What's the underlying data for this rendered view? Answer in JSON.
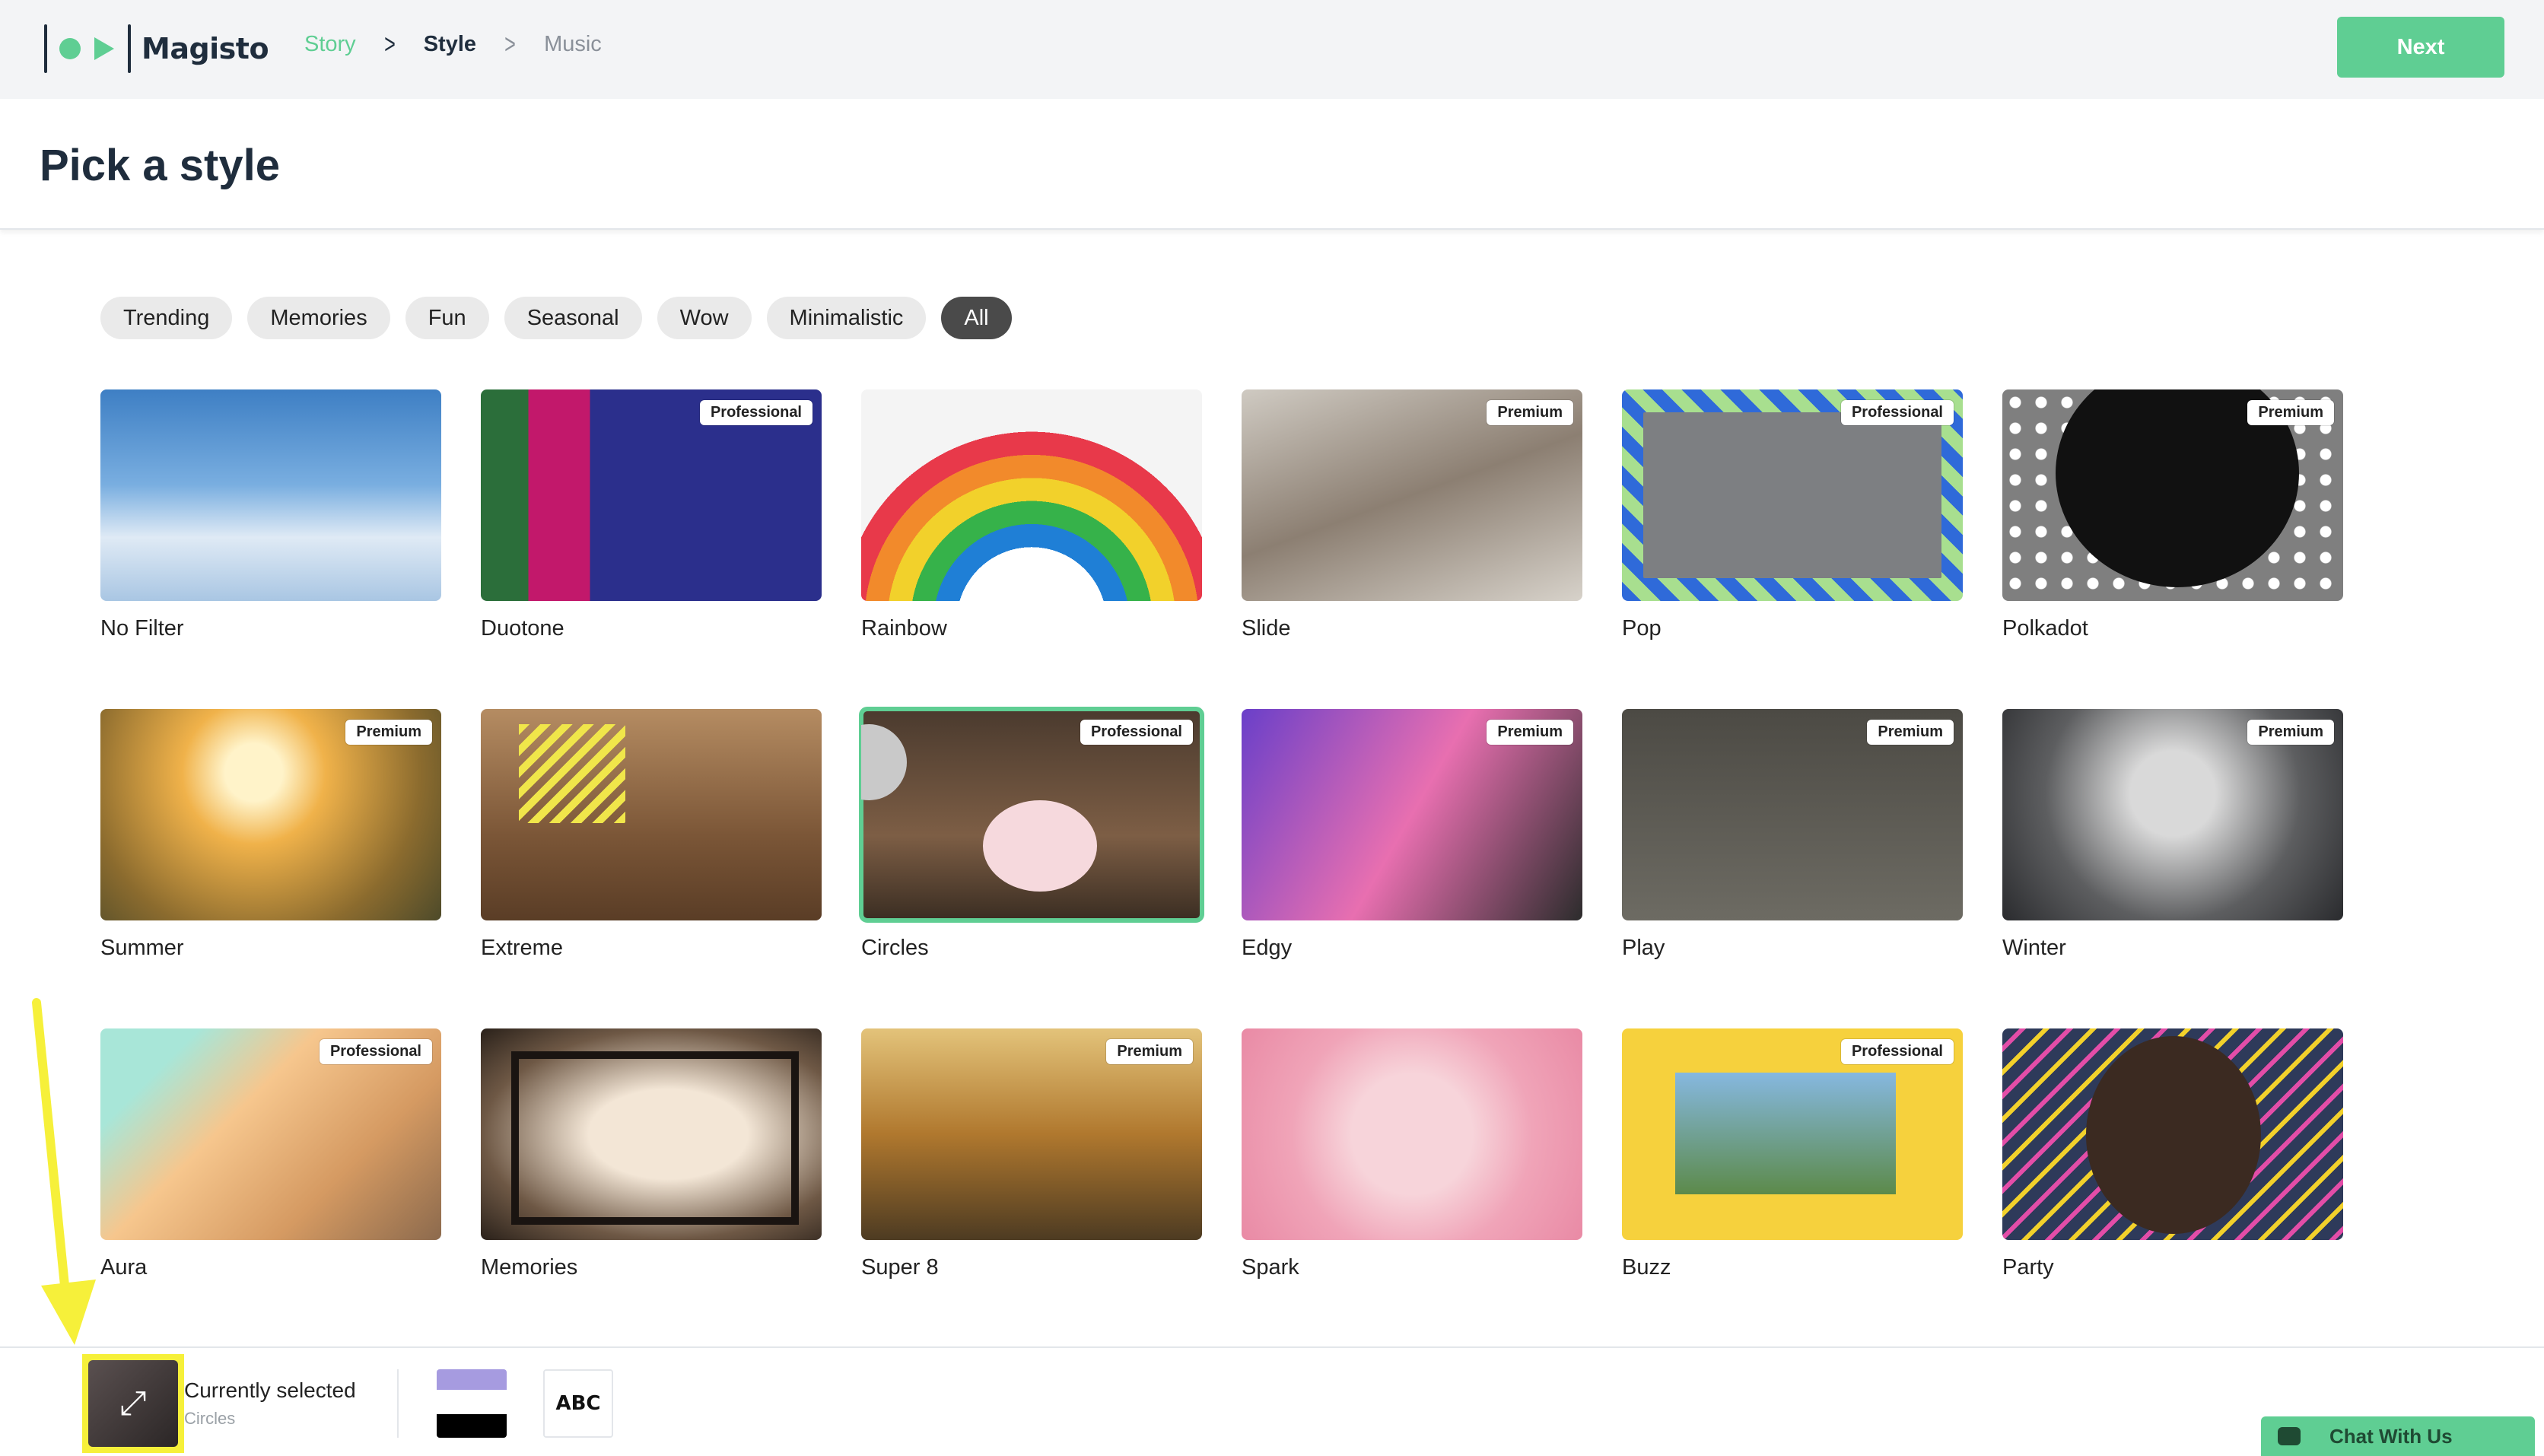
{
  "header": {
    "brand": "Magisto",
    "breadcrumb": [
      "Story",
      "Style",
      "Music"
    ],
    "next_label": "Next"
  },
  "page_title": "Pick a style",
  "filters": [
    "Trending",
    "Memories",
    "Fun",
    "Seasonal",
    "Wow",
    "Minimalistic",
    "All"
  ],
  "active_filter": "All",
  "styles": [
    {
      "name": "No Filter",
      "badge": ""
    },
    {
      "name": "Duotone",
      "badge": "Professional"
    },
    {
      "name": "Rainbow",
      "badge": ""
    },
    {
      "name": "Slide",
      "badge": "Premium"
    },
    {
      "name": "Pop",
      "badge": "Professional"
    },
    {
      "name": "Polkadot",
      "badge": "Premium"
    },
    {
      "name": "Summer",
      "badge": "Premium"
    },
    {
      "name": "Extreme",
      "badge": ""
    },
    {
      "name": "Circles",
      "badge": "Professional"
    },
    {
      "name": "Edgy",
      "badge": "Premium"
    },
    {
      "name": "Play",
      "badge": "Premium"
    },
    {
      "name": "Winter",
      "badge": "Premium"
    },
    {
      "name": "Aura",
      "badge": "Professional"
    },
    {
      "name": "Memories",
      "badge": ""
    },
    {
      "name": "Super 8",
      "badge": "Premium"
    },
    {
      "name": "Spark",
      "badge": ""
    },
    {
      "name": "Buzz",
      "badge": "Professional"
    },
    {
      "name": "Party",
      "badge": ""
    }
  ],
  "selected_style": "Circles",
  "bottom_bar": {
    "current_label": "Currently selected",
    "current_value": "Circles",
    "font_sample": "ABC"
  },
  "chat": {
    "label": "Chat With Us"
  },
  "colors": {
    "accent": "#5fce93",
    "dark": "#1f2d3d",
    "highlight": "#f6f03a",
    "swatch_top": "#a69be0"
  }
}
